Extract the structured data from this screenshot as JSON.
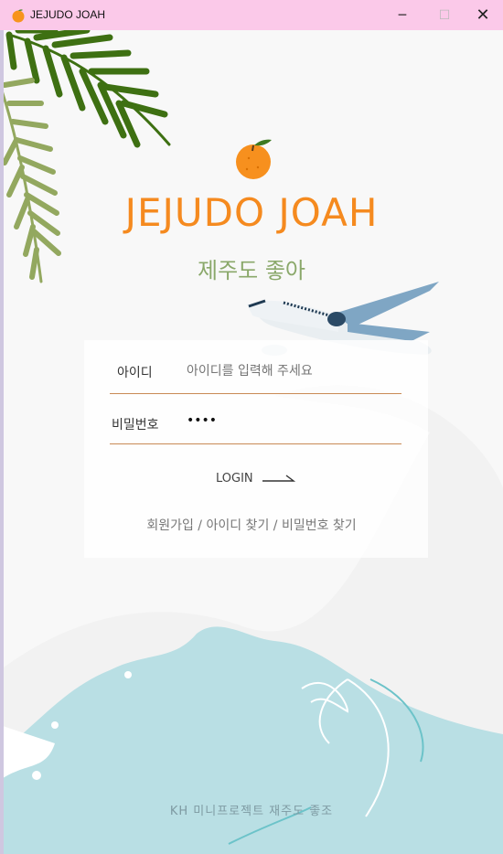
{
  "window": {
    "title": "JEJUDO JOAH",
    "minimize_glyph": "─",
    "maximize_glyph": "☐",
    "close_glyph": "✕"
  },
  "logo": {
    "title_en": "JEJUDO JOAH",
    "title_ko": "제주도 좋아"
  },
  "login_form": {
    "id_label": "아이디",
    "id_placeholder": "아이디를 입력해 주세요",
    "password_label": "비밀번호",
    "password_value": "••••",
    "login_label": "LOGIN"
  },
  "links": {
    "signup": "회원가입",
    "find_id": "아이디 찾기",
    "find_password": "비밀번호 찾기",
    "separator": "/"
  },
  "footer": {
    "text": "KH 미니프로젝트 재주도 좋조"
  },
  "colors": {
    "titlebar": "#fbc9e9",
    "accent_orange": "#f58a1f",
    "leaf_green": "#8aa86a",
    "sea": "#b9dfe4"
  },
  "icons": {
    "app": "tangerine-icon",
    "login_arrow": "arrow-right-icon"
  }
}
